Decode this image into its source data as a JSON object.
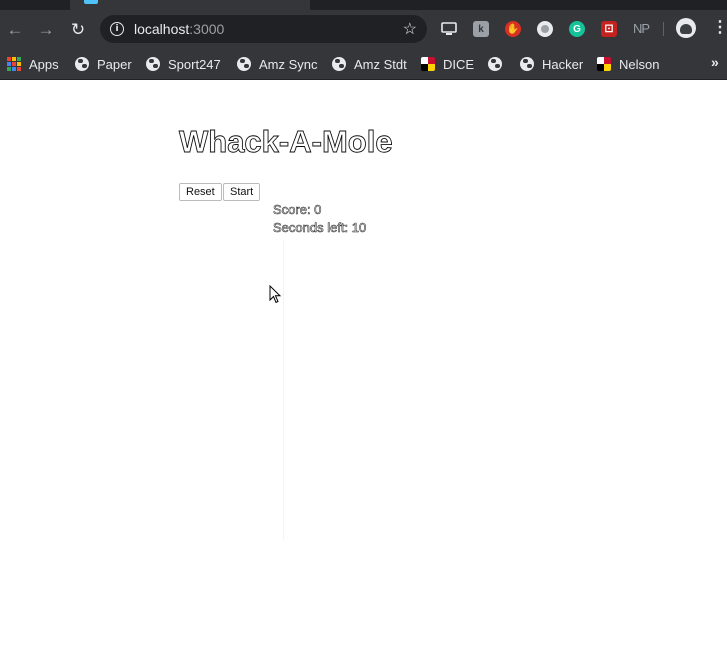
{
  "browser": {
    "url_host": "localhost",
    "url_port": ":3000",
    "extensions": [
      "monitor-extension-icon",
      "bookmark-extension-icon",
      "stop-hand-extension-icon",
      "record-extension-icon",
      "grammarly-extension-icon",
      "dice-extension-icon"
    ],
    "np_label": "NP",
    "bookmarks": [
      {
        "label": "Apps",
        "icon": "apps-grid-icon"
      },
      {
        "label": "Paper",
        "icon": "globe-icon"
      },
      {
        "label": "Sport247",
        "icon": "globe-icon"
      },
      {
        "label": "Amz Sync",
        "icon": "globe-icon"
      },
      {
        "label": "Amz Stdt",
        "icon": "globe-icon"
      },
      {
        "label": "DICE",
        "icon": "maryland-flag-icon"
      },
      {
        "label": "",
        "icon": "globe-icon"
      },
      {
        "label": "Hacker",
        "icon": "globe-icon"
      },
      {
        "label": "Nelson",
        "icon": "maryland-flag-icon"
      }
    ],
    "more_bookmarks": "»"
  },
  "page": {
    "title": "Whack-A-Mole",
    "reset_label": "Reset",
    "start_label": "Start",
    "score_text": "Score: 0",
    "seconds_text": "Seconds left: 10"
  },
  "colors": {
    "chrome_dark": "#35363a",
    "omnibox": "#202124",
    "grammarly": "#15c39a",
    "stop_red": "#d93025"
  }
}
